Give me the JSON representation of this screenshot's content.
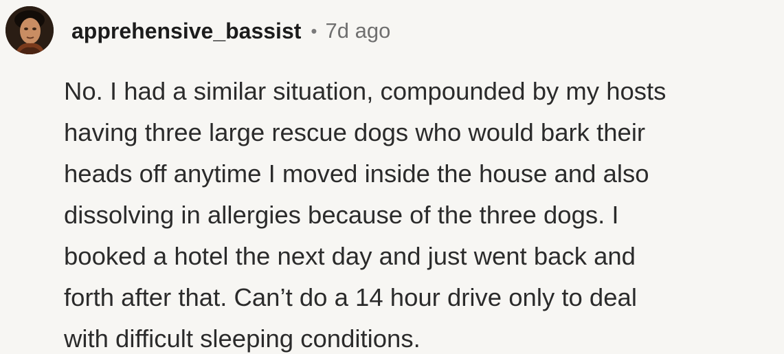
{
  "comment": {
    "avatar": "user-avatar-portrait",
    "username": "apprehensive_bassist",
    "separator": "•",
    "timestamp": "7d ago",
    "body_lines": [
      "No. I had a similar situation, compounded by my hosts",
      "having three large rescue dogs who would bark their",
      "heads off anytime I moved inside the house and also",
      "dissolving in allergies because of the three dogs. I",
      "booked a hotel the next day and just went back and",
      "forth after that. Can’t do a 14 hour drive only to deal",
      "with difficult sleeping conditions."
    ]
  }
}
